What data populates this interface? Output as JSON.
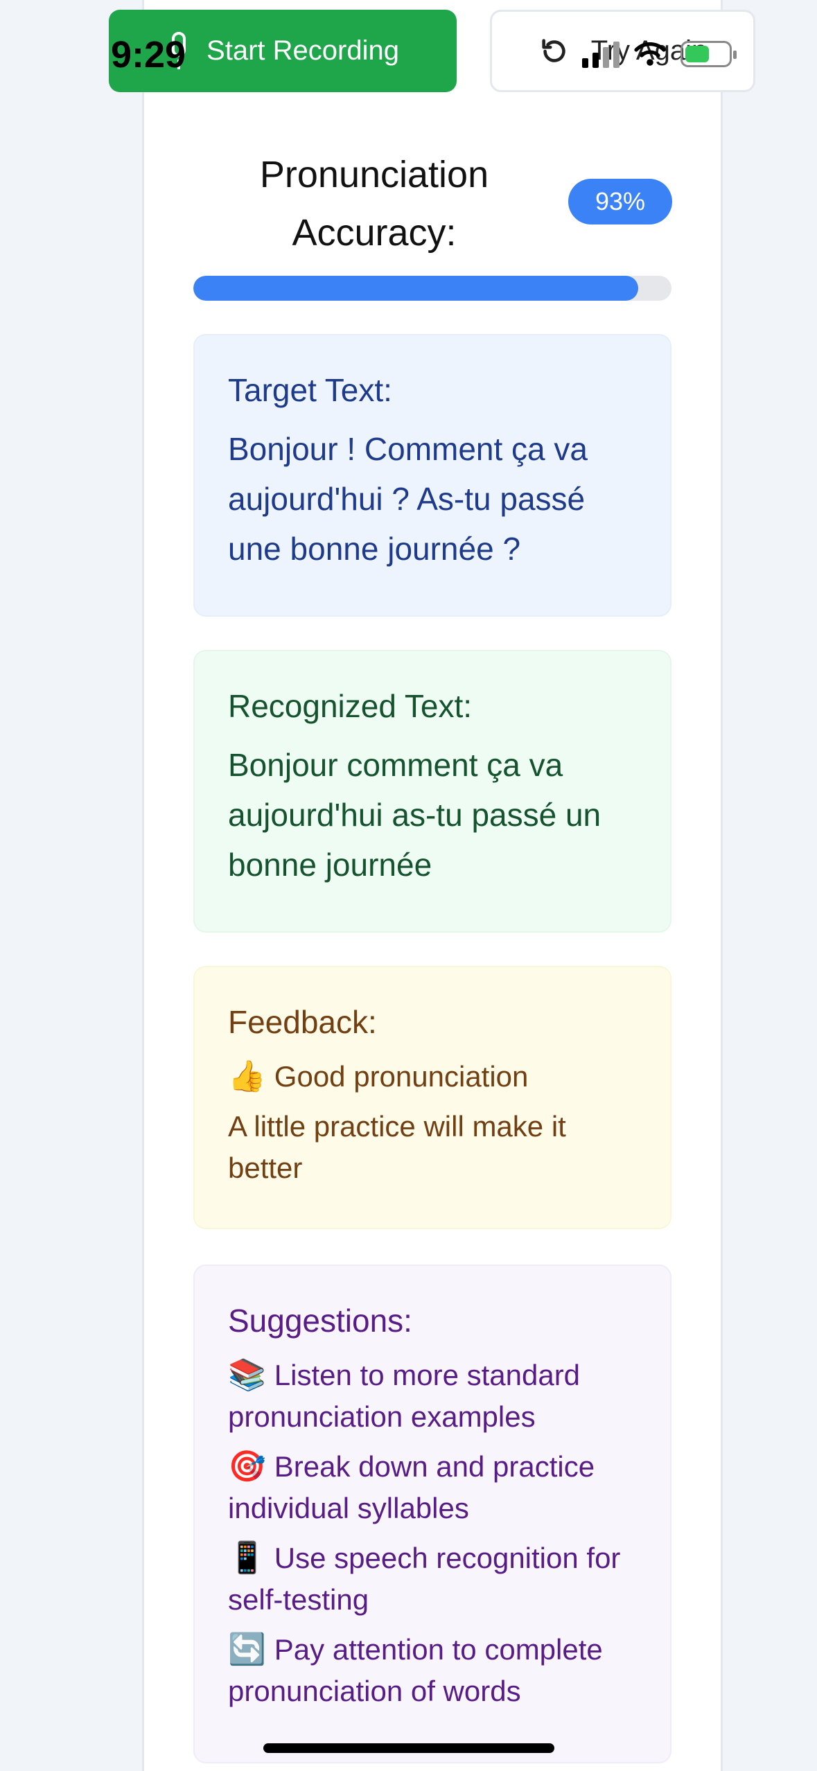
{
  "status_bar": {
    "time": "9:29",
    "battery_color": "#34c759"
  },
  "controls": {
    "record_label": "Start Recording",
    "record_color": "#1fa64a",
    "retry_label": "Try Again"
  },
  "accuracy": {
    "label": "Pronunciation Accuracy:",
    "percent_text": "93%",
    "progress_fraction": 0.93,
    "accent_color": "#3b82f6"
  },
  "target": {
    "heading": "Target Text:",
    "text": "Bonjour ! Comment ça va aujourd'hui ? As-tu passé une bonne journée ?"
  },
  "recognized": {
    "heading": "Recognized Text:",
    "text": "Bonjour comment ça va aujourd'hui as-tu passé un bonne journée"
  },
  "feedback": {
    "heading": "Feedback:",
    "items": [
      {
        "emoji": "👍",
        "text": "Good pronunciation"
      },
      {
        "emoji": "",
        "text": "A little practice will make it better"
      }
    ]
  },
  "suggestions": {
    "heading": "Suggestions:",
    "items": [
      {
        "emoji": "📚",
        "text": "Listen to more standard pronunciation examples"
      },
      {
        "emoji": "🎯",
        "text": "Break down and practice individual syllables"
      },
      {
        "emoji": "📱",
        "text": "Use speech recognition for self-testing"
      },
      {
        "emoji": "🔄",
        "text": "Pay attention to complete pronunciation of words"
      }
    ]
  }
}
